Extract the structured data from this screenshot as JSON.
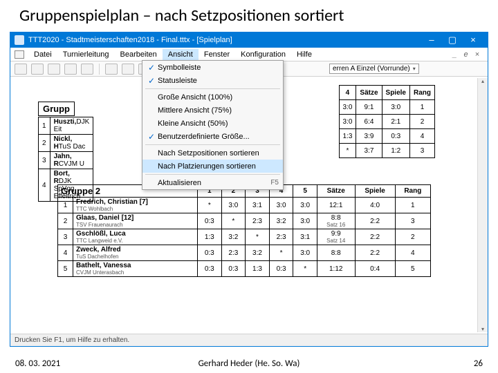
{
  "slide_title": "Gruppenspielplan – nach Setzpositionen sortiert",
  "window": {
    "title": "TTT2020 - Stadtmeisterschaften2018 - Final.tttx - [Spielplan]",
    "status": "Drucken Sie F1, um Hilfe zu erhalten."
  },
  "menubar": [
    "Datei",
    "Turnierleitung",
    "Bearbeiten",
    "Ansicht",
    "Fenster",
    "Konfiguration",
    "Hilfe"
  ],
  "menubar_end": [
    "_",
    "e",
    "×"
  ],
  "combo_class": "erren A Einzel (Vorrunde)",
  "submenu": [
    {
      "label": "Symbolleiste",
      "checked": true
    },
    {
      "label": "Statusleiste",
      "checked": true
    },
    {
      "sep": true
    },
    {
      "label": "Große Ansicht (100%)"
    },
    {
      "label": "Mittlere Ansicht (75%)"
    },
    {
      "label": "Kleine Ansicht (50%)"
    },
    {
      "label": "Benutzerdefinierte Größe...",
      "checked": true
    },
    {
      "sep": true
    },
    {
      "label": "Nach Setzpositionen sortieren"
    },
    {
      "label": "Nach Platzierungen sortieren",
      "hl": true
    },
    {
      "sep": true
    },
    {
      "label": "Aktualisieren",
      "accel": "F5"
    }
  ],
  "behind_header": "orrunde)",
  "group1": {
    "title_visible": "Grupp",
    "cols": [
      "4",
      "Sätze",
      "Spiele",
      "Rang"
    ],
    "rows": [
      [
        "1",
        {
          "name": "Huszti,",
          "club": "DJK Eit"
        },
        [
          "3:0",
          "9:1",
          "3:0",
          "1"
        ]
      ],
      [
        "2",
        {
          "name": "Nickl, H",
          "club": "TuS Dac"
        },
        [
          "3:0",
          "6:4",
          "2:1",
          "2"
        ]
      ],
      [
        "3",
        {
          "name": "Jahn, R",
          "club": "CVJM U"
        },
        [
          "1:3",
          "3:9",
          "0:3",
          "4"
        ]
      ],
      [
        "4",
        {
          "name": "Bort, R",
          "club": "DJK SpVgg Effeltrich"
        },
        [
          "*",
          "3:7",
          "1:2",
          "3"
        ]
      ]
    ]
  },
  "group2": {
    "title": "Gruppe 2",
    "head": [
      "1",
      "2",
      "3",
      "4",
      "5",
      "Sätze",
      "Spiele",
      "Rang"
    ],
    "rows": [
      {
        "idx": "1",
        "name": "Fredrich, Christian [7]",
        "club": "TTC Wohlbach",
        "cells": [
          "*",
          "3:0",
          "3:1",
          "3:0",
          "3:0",
          "12:1",
          "4:0",
          "1"
        ]
      },
      {
        "idx": "2",
        "name": "Glaas, Daniel [12]",
        "club": "TSV Frauenaurach",
        "cells": [
          "0:3",
          "*",
          "2:3",
          "3:2",
          "3:0",
          "8:8",
          "2:2",
          "3"
        ]
      },
      {
        "idx": "2",
        "name_sub": "Satz 16",
        "skip": true
      },
      {
        "idx": "3",
        "name": "Gschlößl, Luca",
        "club": "TTC Langweid e.V.",
        "cells": [
          "1:3",
          "3:2",
          "*",
          "2:3",
          "3:1",
          "9:9",
          "2:2",
          "2"
        ]
      },
      {
        "idx": "3",
        "name_sub": "Satz 14",
        "skip": true
      },
      {
        "idx": "4",
        "name": "Zweck, Alfred",
        "club": "TuS Dachelhofen",
        "cells": [
          "0:3",
          "2:3",
          "3:2",
          "*",
          "3:0",
          "8:8",
          "2:2",
          "4"
        ]
      },
      {
        "idx": "5",
        "name": "Bathelt, Vanessa",
        "club": "CVJM Unterasbach",
        "cells": [
          "0:3",
          "0:3",
          "1:3",
          "0:3",
          "*",
          "1:12",
          "0:4",
          "5"
        ]
      }
    ]
  },
  "footer": {
    "date": "08. 03. 2021",
    "author": "Gerhard Heder (He. So. Wa)",
    "page": "26"
  }
}
